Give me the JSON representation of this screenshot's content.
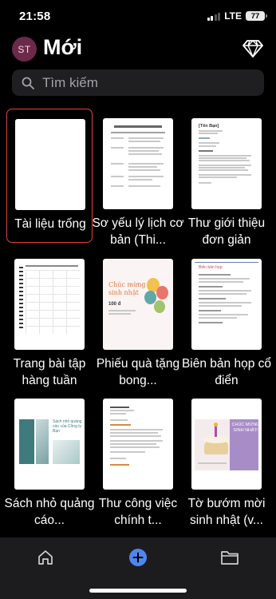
{
  "status_bar": {
    "time": "21:58",
    "network": "LTE",
    "battery": "77"
  },
  "header": {
    "avatar_initials": "ST",
    "title": "Mới"
  },
  "search": {
    "placeholder": "Tìm kiếm"
  },
  "templates": [
    {
      "label": "Tài liệu trống",
      "selected": true
    },
    {
      "label": "Sơ yếu lý lịch cơ bản (Thi..."
    },
    {
      "label": "Thư giới thiệu đơn giản",
      "thumb_text": "[Tên Bạn]"
    },
    {
      "label": "Trang bài tập hàng tuần"
    },
    {
      "label": "Phiếu quà tặng bong...",
      "thumb_title": "Chúc mừng sinh nhật",
      "thumb_amount": "100 đ"
    },
    {
      "label": "Biên bản họp cổ điển",
      "thumb_title": "Biên bản họp"
    },
    {
      "label": "Sách nhỏ quảng cáo...",
      "thumb_title": "Sách nhỏ quảng cáo của Công ty Bạn"
    },
    {
      "label": "Thư công việc chính t..."
    },
    {
      "label": "Tờ bướm mời sinh nhật (v...",
      "thumb_title": "CHÚC MỪNG SINH NHẬT!"
    }
  ],
  "nav": {
    "home_icon": "home-icon",
    "new_icon": "plus-icon",
    "files_icon": "folder-icon"
  },
  "colors": {
    "accent_selected": "#e0453a",
    "nav_active": "#4f86ee",
    "avatar_bg": "#6b2a4a"
  }
}
